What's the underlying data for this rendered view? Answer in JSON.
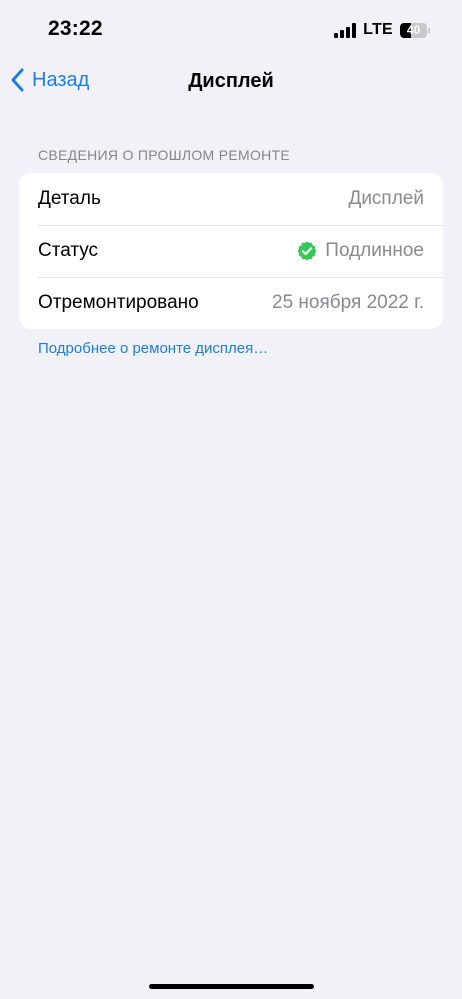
{
  "status_bar": {
    "time": "23:22",
    "network": "LTE",
    "battery_level": "40",
    "battery_fraction": 0.4
  },
  "nav": {
    "back_label": "Назад",
    "title": "Дисплей"
  },
  "section": {
    "header": "СВЕДЕНИЯ О ПРОШЛОМ РЕМОНТЕ",
    "rows": [
      {
        "label": "Деталь",
        "value": "Дисплей"
      },
      {
        "label": "Статус",
        "value": "Подлинное",
        "icon": "verified-check-icon"
      },
      {
        "label": "Отремонтировано",
        "value": "25 ноября 2022 г."
      }
    ],
    "footer_link": "Подробнее о ремонте дисплея…"
  },
  "colors": {
    "accent": "#1a7ee8",
    "verified": "#34c759",
    "background": "#f2f1f7"
  }
}
